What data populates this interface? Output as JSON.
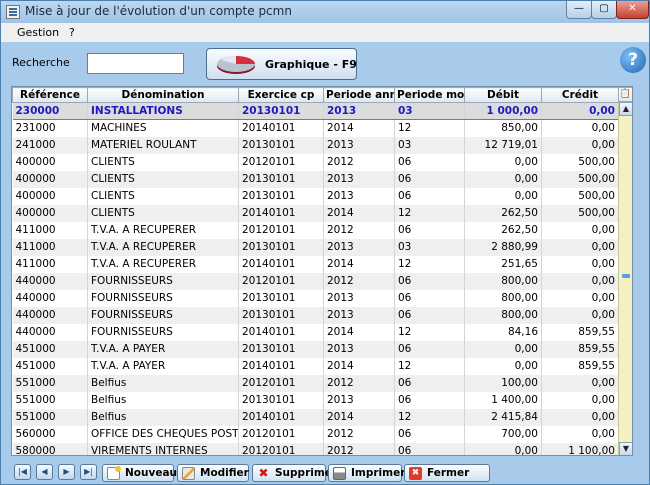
{
  "window": {
    "title": "Mise à jour de l'évolution d'un compte pcmn",
    "controls": {
      "minimize": "—",
      "maximize": "▢",
      "close": "✕"
    }
  },
  "menu": {
    "gestion": "Gestion",
    "help": "?"
  },
  "search": {
    "label": "Recherche",
    "value": ""
  },
  "graph_button": {
    "label": "Graphique - F9",
    "icon": "pie-chart-icon"
  },
  "help_icon": "?",
  "table": {
    "columns": [
      "Référence",
      "Dénomination",
      "Exercice cp",
      "Periode année",
      "Periode mois",
      "Débit",
      "Crédit"
    ],
    "corner_icon": "📋",
    "rows": [
      {
        "ref": "230000",
        "name": "INSTALLATIONS",
        "exercice": "20130101",
        "annee": "2013",
        "mois": "03",
        "debit": "1 000,00",
        "credit": "0,00"
      },
      {
        "ref": "231000",
        "name": "MACHINES",
        "exercice": "20140101",
        "annee": "2014",
        "mois": "12",
        "debit": "850,00",
        "credit": "0,00"
      },
      {
        "ref": "241000",
        "name": "MATERIEL ROULANT",
        "exercice": "20130101",
        "annee": "2013",
        "mois": "03",
        "debit": "12 719,01",
        "credit": "0,00"
      },
      {
        "ref": "400000",
        "name": "CLIENTS",
        "exercice": "20120101",
        "annee": "2012",
        "mois": "06",
        "debit": "0,00",
        "credit": "500,00"
      },
      {
        "ref": "400000",
        "name": "CLIENTS",
        "exercice": "20130101",
        "annee": "2013",
        "mois": "06",
        "debit": "0,00",
        "credit": "500,00"
      },
      {
        "ref": "400000",
        "name": "CLIENTS",
        "exercice": "20130101",
        "annee": "2013",
        "mois": "06",
        "debit": "0,00",
        "credit": "500,00"
      },
      {
        "ref": "400000",
        "name": "CLIENTS",
        "exercice": "20140101",
        "annee": "2014",
        "mois": "12",
        "debit": "262,50",
        "credit": "500,00"
      },
      {
        "ref": "411000",
        "name": "T.V.A. A RECUPERER",
        "exercice": "20120101",
        "annee": "2012",
        "mois": "06",
        "debit": "262,50",
        "credit": "0,00"
      },
      {
        "ref": "411000",
        "name": "T.V.A. A RECUPERER",
        "exercice": "20130101",
        "annee": "2013",
        "mois": "03",
        "debit": "2 880,99",
        "credit": "0,00"
      },
      {
        "ref": "411000",
        "name": "T.V.A. A RECUPERER",
        "exercice": "20140101",
        "annee": "2014",
        "mois": "12",
        "debit": "251,65",
        "credit": "0,00"
      },
      {
        "ref": "440000",
        "name": "FOURNISSEURS",
        "exercice": "20120101",
        "annee": "2012",
        "mois": "06",
        "debit": "800,00",
        "credit": "0,00"
      },
      {
        "ref": "440000",
        "name": "FOURNISSEURS",
        "exercice": "20130101",
        "annee": "2013",
        "mois": "06",
        "debit": "800,00",
        "credit": "0,00"
      },
      {
        "ref": "440000",
        "name": "FOURNISSEURS",
        "exercice": "20130101",
        "annee": "2013",
        "mois": "06",
        "debit": "800,00",
        "credit": "0,00"
      },
      {
        "ref": "440000",
        "name": "FOURNISSEURS",
        "exercice": "20140101",
        "annee": "2014",
        "mois": "12",
        "debit": "84,16",
        "credit": "859,55"
      },
      {
        "ref": "451000",
        "name": "T.V.A. A PAYER",
        "exercice": "20130101",
        "annee": "2013",
        "mois": "06",
        "debit": "0,00",
        "credit": "859,55"
      },
      {
        "ref": "451000",
        "name": "T.V.A. A PAYER",
        "exercice": "20140101",
        "annee": "2014",
        "mois": "12",
        "debit": "0,00",
        "credit": "859,55"
      },
      {
        "ref": "551000",
        "name": "Belfius",
        "exercice": "20120101",
        "annee": "2012",
        "mois": "06",
        "debit": "100,00",
        "credit": "0,00"
      },
      {
        "ref": "551000",
        "name": "Belfius",
        "exercice": "20130101",
        "annee": "2013",
        "mois": "06",
        "debit": "1 400,00",
        "credit": "0,00"
      },
      {
        "ref": "551000",
        "name": "Belfius",
        "exercice": "20140101",
        "annee": "2014",
        "mois": "12",
        "debit": "2 415,84",
        "credit": "0,00"
      },
      {
        "ref": "560000",
        "name": "OFFICE DES CHEQUES POSTAUX",
        "exercice": "20120101",
        "annee": "2012",
        "mois": "06",
        "debit": "700,00",
        "credit": "0,00"
      },
      {
        "ref": "580000",
        "name": "VIREMENTS INTERNES",
        "exercice": "20120101",
        "annee": "2012",
        "mois": "06",
        "debit": "0,00",
        "credit": "1 100,00"
      }
    ]
  },
  "scrollbar": {
    "up": "▲",
    "down": "▼"
  },
  "navigation": {
    "first": "|◀",
    "prev": "◀",
    "next": "▶",
    "last": "▶|"
  },
  "actions": {
    "new": "Nouveau",
    "edit": "Modifier",
    "delete": "Supprimer",
    "delete_glyph": "✖",
    "print": "Imprimer",
    "close": "Fermer",
    "close_glyph": "✖"
  }
}
